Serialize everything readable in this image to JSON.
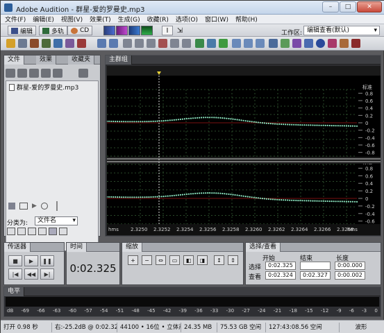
{
  "window": {
    "title": "Adobe Audition - 群星-爱的罗曼史.mp3",
    "controls": [
      "–",
      "□",
      "✕"
    ]
  },
  "menu": [
    "文件(F)",
    "编辑(E)",
    "视图(V)",
    "效果(T)",
    "生成(G)",
    "收藏(R)",
    "选项(O)",
    "窗口(W)",
    "帮助(H)"
  ],
  "modebar": {
    "edit_label": "编辑",
    "multitrack_label": "多轨",
    "cd_label": "CD",
    "workspace_label": "工作区:",
    "workspace_value": "编辑查看(默认)"
  },
  "files_panel": {
    "tabs": [
      "文件",
      "效果",
      "收藏夹"
    ],
    "file_name": "群星-爱的罗曼史.mp3",
    "sort_label": "分类为:",
    "sort_value": "文件名"
  },
  "main_panel": {
    "tab": "主群组",
    "amplitude_label": "标准",
    "y_ticks": [
      "0.8",
      "0.6",
      "0.4",
      "0.2",
      "0",
      "-0.2",
      "-0.4",
      "-0.6",
      "-0.8"
    ],
    "time_unit": "hms",
    "time_ticks": [
      "2.3250",
      "2.3252",
      "2.3254",
      "2.3256",
      "2.3258",
      "2.3260",
      "2.3262",
      "2.3264",
      "2.3266",
      "2.3268"
    ]
  },
  "transport": {
    "tab": "传送器"
  },
  "time_panel": {
    "tab": "时间",
    "value": "0:02.325"
  },
  "zoom_panel": {
    "tab": "缩放"
  },
  "selview": {
    "tab": "选择/查看",
    "headers": {
      "start": "开始",
      "end": "结束",
      "length": "长度"
    },
    "selection_label": "选择",
    "view_label": "查看",
    "selection": {
      "start": "0:02.325",
      "end": "",
      "length": "0:00.000"
    },
    "view": {
      "start": "0:02.324",
      "end": "0:02.327",
      "length": "0:00.002"
    }
  },
  "level_panel": {
    "tab": "电平",
    "scale": [
      "dB",
      "-69",
      "-66",
      "-63",
      "-60",
      "-57",
      "-54",
      "-51",
      "-48",
      "-45",
      "-42",
      "-39",
      "-36",
      "-33",
      "-30",
      "-27",
      "-24",
      "-21",
      "-18",
      "-15",
      "-12",
      "-9",
      "-6",
      "-3",
      "0"
    ]
  },
  "status": {
    "open_time": "打开 0.98 秒",
    "level": "右:-25.2dB @ 0:02.325",
    "format": "44100 • 16位 • 立体声",
    "file_size": "24.35 MB",
    "disk_free": "75.53 GB 空闲",
    "time_free": "127:43:08.56 空闲",
    "view_mode": "波形"
  }
}
